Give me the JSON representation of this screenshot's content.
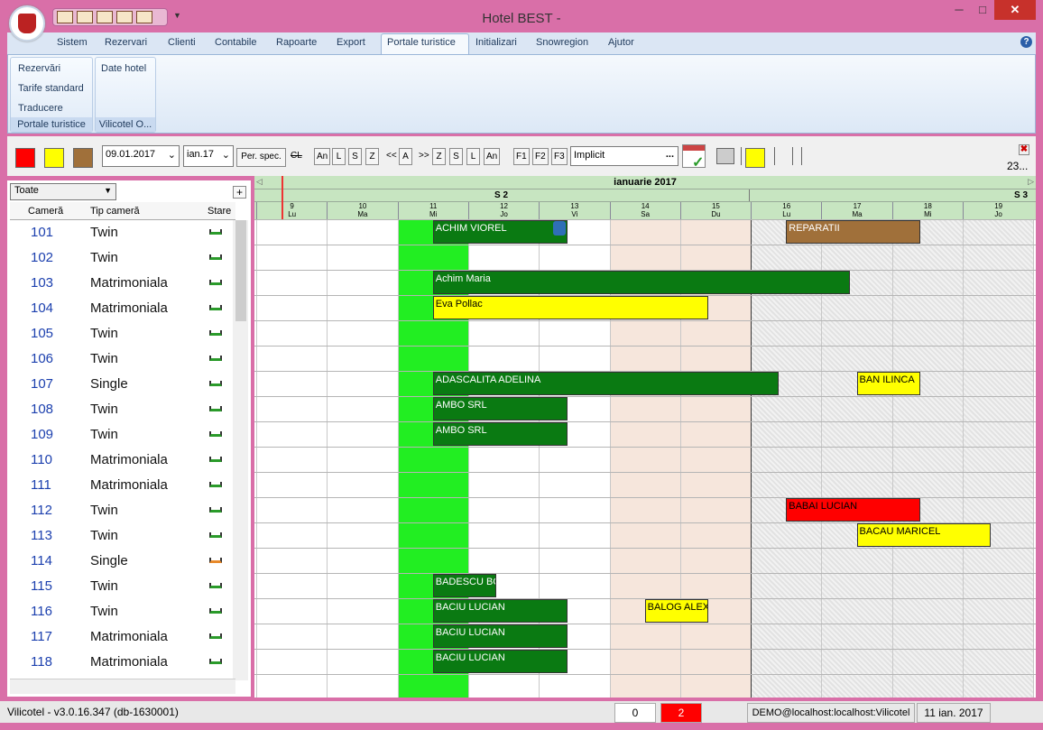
{
  "title_bar": {
    "title": "Hotel BEST -",
    "minimize": "─",
    "maximize": "□",
    "close": "✕"
  },
  "menu": {
    "items": [
      "Sistem",
      "Rezervari",
      "Clienti",
      "Contabile",
      "Rapoarte",
      "Export",
      "Portale turistice",
      "Initializari",
      "Snowregion",
      "Ajutor"
    ],
    "active": "Portale turistice"
  },
  "ribbon": {
    "group1": {
      "items": [
        "Rezervări",
        "Tarife standard",
        "Traducere"
      ],
      "label": "Portale turistice"
    },
    "group2": {
      "items": [
        "Date hotel"
      ],
      "label": "Vilicotel O..."
    }
  },
  "toolbar": {
    "date": "09.01.2017",
    "month": "ian.17",
    "per_spec": "Per. spec.",
    "cl": "CL",
    "nav": [
      "An",
      "L",
      "S",
      "Z",
      "<<",
      "A",
      ">>",
      "Z",
      "S",
      "L",
      "An"
    ],
    "fkeys": [
      "F1",
      "F2",
      "F3"
    ],
    "view": "Implicit",
    "view_more": "...",
    "right_counter": "23..."
  },
  "left_pane": {
    "filter": "Toate",
    "add": "+",
    "headers": {
      "room": "Cameră",
      "type": "Tip cameră",
      "state": "Stare"
    },
    "rooms": [
      {
        "no": "101",
        "type": "Twin"
      },
      {
        "no": "102",
        "type": "Twin"
      },
      {
        "no": "103",
        "type": "Matrimoniala"
      },
      {
        "no": "104",
        "type": "Matrimoniala"
      },
      {
        "no": "105",
        "type": "Twin"
      },
      {
        "no": "106",
        "type": "Twin"
      },
      {
        "no": "107",
        "type": "Single"
      },
      {
        "no": "108",
        "type": "Twin"
      },
      {
        "no": "109",
        "type": "Twin"
      },
      {
        "no": "110",
        "type": "Matrimoniala"
      },
      {
        "no": "111",
        "type": "Matrimoniala"
      },
      {
        "no": "112",
        "type": "Twin"
      },
      {
        "no": "113",
        "type": "Twin"
      },
      {
        "no": "114",
        "type": "Single"
      },
      {
        "no": "115",
        "type": "Twin"
      },
      {
        "no": "116",
        "type": "Twin"
      },
      {
        "no": "117",
        "type": "Matrimoniala"
      },
      {
        "no": "118",
        "type": "Matrimoniala"
      }
    ]
  },
  "calendar": {
    "month": "ianuarie 2017",
    "weeks": [
      "S 2",
      "S 3"
    ],
    "days": [
      {
        "d": "9",
        "w": "Lu"
      },
      {
        "d": "10",
        "w": "Ma"
      },
      {
        "d": "11",
        "w": "Mi"
      },
      {
        "d": "12",
        "w": "Jo"
      },
      {
        "d": "13",
        "w": "Vi"
      },
      {
        "d": "14",
        "w": "Sa"
      },
      {
        "d": "15",
        "w": "Du"
      },
      {
        "d": "16",
        "w": "Lu"
      },
      {
        "d": "17",
        "w": "Ma"
      },
      {
        "d": "18",
        "w": "Mi"
      },
      {
        "d": "19",
        "w": "Jo"
      }
    ],
    "reservations": [
      {
        "name": "ACHIM VIOREL",
        "row": 0,
        "start": 2.5,
        "end": 4.4,
        "color": "#0a7a12",
        "text": "#fff"
      },
      {
        "name": "REPARATII",
        "row": 0,
        "start": 7.5,
        "end": 9.4,
        "color": "#a0703a",
        "text": "#fff"
      },
      {
        "name": "Achim Maria",
        "row": 2,
        "start": 2.5,
        "end": 8.4,
        "color": "#0a7a12",
        "text": "#fff"
      },
      {
        "name": "Eva Pollac",
        "row": 3,
        "start": 2.5,
        "end": 6.4,
        "color": "#ffff00",
        "text": "#000"
      },
      {
        "name": "ADASCALITA ADELINA",
        "row": 6,
        "start": 2.5,
        "end": 7.4,
        "color": "#0a7a12",
        "text": "#fff"
      },
      {
        "name": "BAN ILINCA",
        "row": 6,
        "start": 8.5,
        "end": 9.4,
        "color": "#ffff00",
        "text": "#000"
      },
      {
        "name": "AMBO SRL",
        "row": 7,
        "start": 2.5,
        "end": 4.4,
        "color": "#0a7a12",
        "text": "#fff"
      },
      {
        "name": "AMBO SRL",
        "row": 8,
        "start": 2.5,
        "end": 4.4,
        "color": "#0a7a12",
        "text": "#fff"
      },
      {
        "name": "BABAI LUCIAN",
        "row": 11,
        "start": 7.5,
        "end": 9.4,
        "color": "#ff0000",
        "text": "#000"
      },
      {
        "name": "BACAU MARICEL",
        "row": 12,
        "start": 8.5,
        "end": 10.4,
        "color": "#ffff00",
        "text": "#000"
      },
      {
        "name": "BADESCU BO",
        "row": 14,
        "start": 2.5,
        "end": 3.4,
        "color": "#0a7a12",
        "text": "#fff"
      },
      {
        "name": "BACIU LUCIAN",
        "row": 15,
        "start": 2.5,
        "end": 4.4,
        "color": "#0a7a12",
        "text": "#fff"
      },
      {
        "name": "BALOG ALEX",
        "row": 15,
        "start": 5.5,
        "end": 6.4,
        "color": "#ffff00",
        "text": "#000"
      },
      {
        "name": "BACIU LUCIAN",
        "row": 16,
        "start": 2.5,
        "end": 4.4,
        "color": "#0a7a12",
        "text": "#fff"
      },
      {
        "name": "BACIU LUCIAN",
        "row": 17,
        "start": 2.5,
        "end": 4.4,
        "color": "#0a7a12",
        "text": "#fff"
      }
    ]
  },
  "status_bar": {
    "version": "Vilicotel - v3.0.16.347 (db-1630001)",
    "count1": "0",
    "count2": "2",
    "connection": "DEMO@localhost:localhost:Vilicotel",
    "date": "11 ian. 2017"
  },
  "colors": {
    "today": "#22ee22",
    "weekend": "#f6e6dc",
    "accent_red": "#ff0000",
    "reserved_green": "#0a7a12"
  }
}
